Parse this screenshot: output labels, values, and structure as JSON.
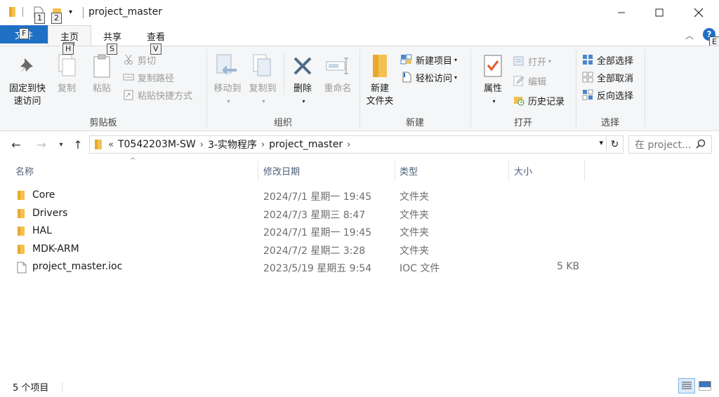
{
  "window": {
    "title": "project_master",
    "keytips": {
      "qa1": "1",
      "qa2": "2",
      "file": "F",
      "home": "H",
      "share": "S",
      "view": "V",
      "help": "E"
    }
  },
  "tabs": {
    "file": "文件",
    "home": "主页",
    "share": "共享",
    "view": "查看"
  },
  "ribbon": {
    "clipboard": {
      "label": "剪贴板",
      "pin_line1": "固定到快",
      "pin_line2": "速访问",
      "copy": "复制",
      "paste": "粘贴",
      "cut": "剪切",
      "copy_path": "复制路径",
      "paste_shortcut": "粘贴快捷方式"
    },
    "organize": {
      "label": "组织",
      "move_to": "移动到",
      "copy_to": "复制到",
      "delete": "删除",
      "rename": "重命名"
    },
    "new": {
      "label": "新建",
      "new_folder_line1": "新建",
      "new_folder_line2": "文件夹",
      "new_item": "新建项目",
      "easy_access": "轻松访问"
    },
    "open": {
      "label": "打开",
      "properties": "属性",
      "open": "打开",
      "edit": "编辑",
      "history": "历史记录"
    },
    "select": {
      "label": "选择",
      "select_all": "全部选择",
      "select_none": "全部取消",
      "invert": "反向选择"
    }
  },
  "address": {
    "prefix": "«",
    "crumbs": [
      "T0542203M-SW",
      "3-实物程序",
      "project_master"
    ],
    "search_placeholder": "在 project..."
  },
  "columns": {
    "name": "名称",
    "modified": "修改日期",
    "type": "类型",
    "size": "大小"
  },
  "files": [
    {
      "name": "Core",
      "modified": "2024/7/1 星期一 19:45",
      "type": "文件夹",
      "size": "",
      "kind": "folder"
    },
    {
      "name": "Drivers",
      "modified": "2024/7/3 星期三 8:47",
      "type": "文件夹",
      "size": "",
      "kind": "folder"
    },
    {
      "name": "HAL",
      "modified": "2024/7/1 星期一 19:45",
      "type": "文件夹",
      "size": "",
      "kind": "folder"
    },
    {
      "name": "MDK-ARM",
      "modified": "2024/7/2 星期二 3:28",
      "type": "文件夹",
      "size": "",
      "kind": "folder"
    },
    {
      "name": "project_master.ioc",
      "modified": "2023/5/19 星期五 9:54",
      "type": "IOC 文件",
      "size": "5 KB",
      "kind": "file"
    }
  ],
  "status": {
    "count": "5 个项目"
  },
  "colors": {
    "accent": "#1f6fc5",
    "folder": "#f4c150",
    "header_text": "#4c607a"
  }
}
